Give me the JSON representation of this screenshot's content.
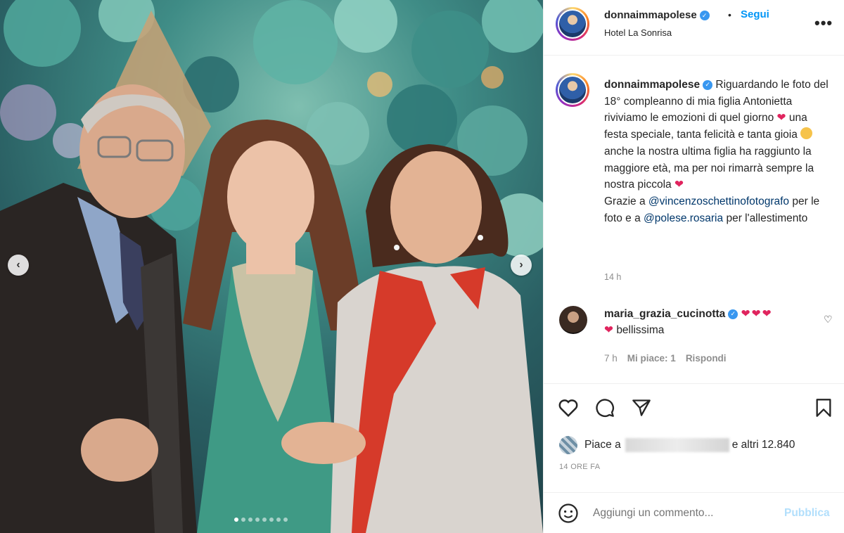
{
  "post": {
    "username": "donnaimmapolese",
    "follow_label": "Segui",
    "bullet": "•",
    "location": "Hotel La Sonrisa",
    "more_label": "•••"
  },
  "caption": {
    "username": "donnaimmapolese",
    "text_1": "Riguardando le foto del 18° compleanno di mia figlia Antonietta riviviamo le emozioni di quel giorno",
    "heart_1": "❤",
    "text_2": "una festa speciale, tanta felicità e tanta gioia",
    "text_3": "anche la nostra ultima figlia ha raggiunto la maggiore età, ma per noi rimarrà sempre la nostra piccola",
    "heart_2": "❤",
    "thanks_prefix": "Grazie a",
    "mention_1": "@vincenzoschettinofotografo",
    "thanks_middle": "per le foto e a",
    "mention_2": "@polese.rosaria",
    "thanks_suffix": "per l'allestimento",
    "time": "14 h"
  },
  "comment": {
    "username": "maria_grazia_cucinotta",
    "hearts": "❤❤❤",
    "heart_line": "❤",
    "text": "bellissima",
    "time": "7 h",
    "likes": "Mi piace: 1",
    "reply": "Rispondi"
  },
  "likes": {
    "prefix": "Piace a",
    "suffix": "e altri 12.840"
  },
  "date_label": "14 ORE FA",
  "comment_input": {
    "placeholder": "Aggiungi un commento..."
  },
  "publish_label": "Pubblica",
  "carousel": {
    "prev_icon": "‹",
    "next_icon": "›",
    "slide_count": 8,
    "active_index": 0
  },
  "colors": {
    "link": "#0095f6",
    "mention": "#00376b",
    "muted": "#8e8e8e",
    "heart": "#e0245e",
    "verified": "#3897f0"
  }
}
